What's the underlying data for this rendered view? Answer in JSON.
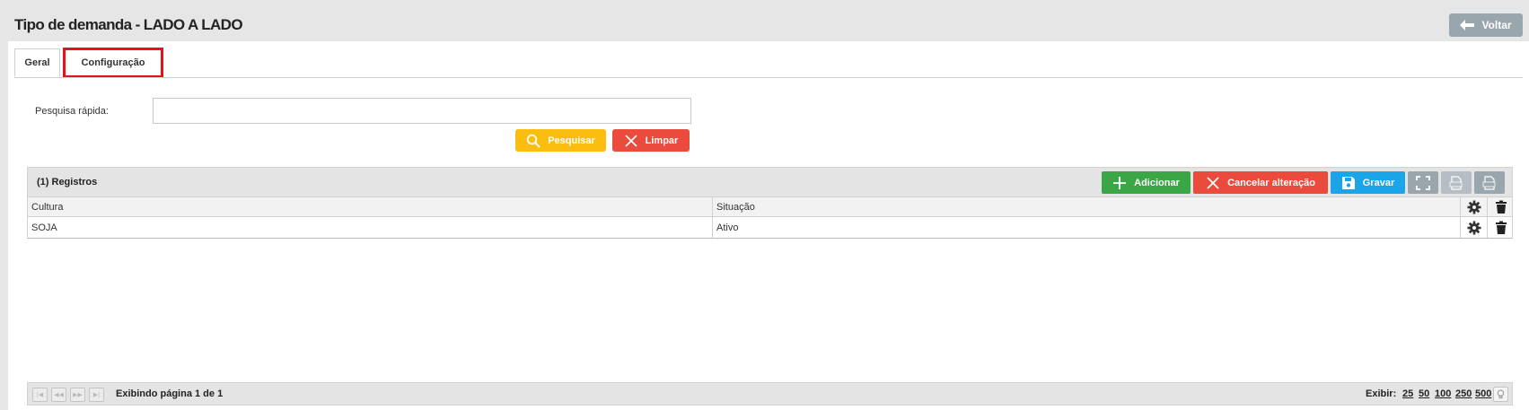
{
  "header": {
    "title": "Tipo de demanda - LADO A LADO",
    "back_label": "Voltar"
  },
  "tabs": [
    {
      "label": "Geral",
      "active": true
    },
    {
      "label": "Configuração",
      "highlighted": true
    }
  ],
  "search": {
    "label": "Pesquisa rápida:",
    "value": "",
    "placeholder": "",
    "search_label": "Pesquisar",
    "clear_label": "Limpar"
  },
  "grid": {
    "records_label": "(1) Registros",
    "toolbar": {
      "add_label": "Adicionar",
      "cancel_label": "Cancelar alteração",
      "save_label": "Gravar",
      "icons": [
        "expand-icon",
        "csv-export-icon",
        "xls-export-icon"
      ]
    },
    "columns": [
      "Cultura",
      "Situação"
    ],
    "rows": [
      {
        "cultura": "SOJA",
        "situacao": "Ativo"
      }
    ]
  },
  "pager": {
    "info": "Exibindo página 1 de 1",
    "show_label": "Exibir:",
    "sizes": [
      "25",
      "50",
      "100",
      "250",
      "500"
    ]
  },
  "colors": {
    "background": "#e6e6e6",
    "add": "#3aa645",
    "cancel": "#ea4b3c",
    "save": "#1aa5e8",
    "search": "#fbbd10",
    "gray": "#9aa6ae",
    "highlight": "#e8101d"
  }
}
